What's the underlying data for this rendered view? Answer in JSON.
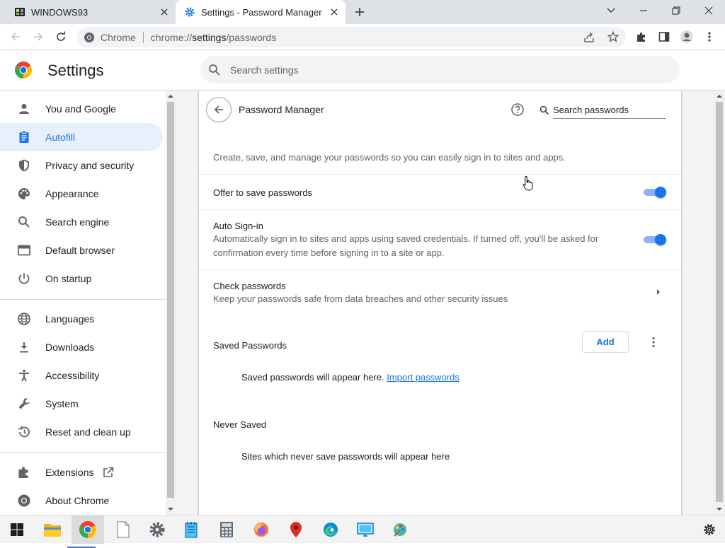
{
  "browser": {
    "tabs": [
      {
        "title": "WINDOWS93",
        "active": false
      },
      {
        "title": "Settings - Password Manager",
        "active": true
      }
    ],
    "omnibox": {
      "site_name": "Chrome",
      "url_prefix": "chrome://",
      "url_host": "settings",
      "url_path": "/passwords"
    }
  },
  "settings": {
    "title": "Settings",
    "search_placeholder": "Search settings",
    "nav": [
      {
        "label": "You and Google",
        "icon": "person-icon"
      },
      {
        "label": "Autofill",
        "icon": "clipboard-icon",
        "active": true
      },
      {
        "label": "Privacy and security",
        "icon": "shield-icon"
      },
      {
        "label": "Appearance",
        "icon": "palette-icon"
      },
      {
        "label": "Search engine",
        "icon": "search-icon"
      },
      {
        "label": "Default browser",
        "icon": "browser-icon"
      },
      {
        "label": "On startup",
        "icon": "power-icon"
      },
      {
        "label": "Languages",
        "icon": "globe-icon"
      },
      {
        "label": "Downloads",
        "icon": "download-icon"
      },
      {
        "label": "Accessibility",
        "icon": "accessibility-icon"
      },
      {
        "label": "System",
        "icon": "wrench-icon"
      },
      {
        "label": "Reset and clean up",
        "icon": "history-icon"
      },
      {
        "label": "Extensions",
        "icon": "puzzle-icon"
      },
      {
        "label": "About Chrome",
        "icon": "chrome-icon"
      }
    ]
  },
  "password_manager": {
    "title": "Password Manager",
    "search_placeholder": "Search passwords",
    "description": "Create, save, and manage your passwords so you can easily sign in to sites and apps.",
    "offer_to_save": {
      "label": "Offer to save passwords",
      "enabled": true
    },
    "auto_signin": {
      "label": "Auto Sign-in",
      "description": "Automatically sign in to sites and apps using saved credentials. If turned off, you'll be asked for confirmation every time before signing in to a site or app.",
      "enabled": true
    },
    "check_passwords": {
      "label": "Check passwords",
      "description": "Keep your passwords safe from data breaches and other security issues"
    },
    "saved_passwords": {
      "heading": "Saved Passwords",
      "add_label": "Add",
      "empty_text": "Saved passwords will appear here.",
      "import_link": "Import passwords"
    },
    "never_saved": {
      "heading": "Never Saved",
      "empty_text": "Sites which never save passwords will appear here"
    }
  },
  "colors": {
    "accent": "#1a73e8",
    "accent_light": "#8ab4f8",
    "nav_active_bg": "#e8f0fe"
  }
}
